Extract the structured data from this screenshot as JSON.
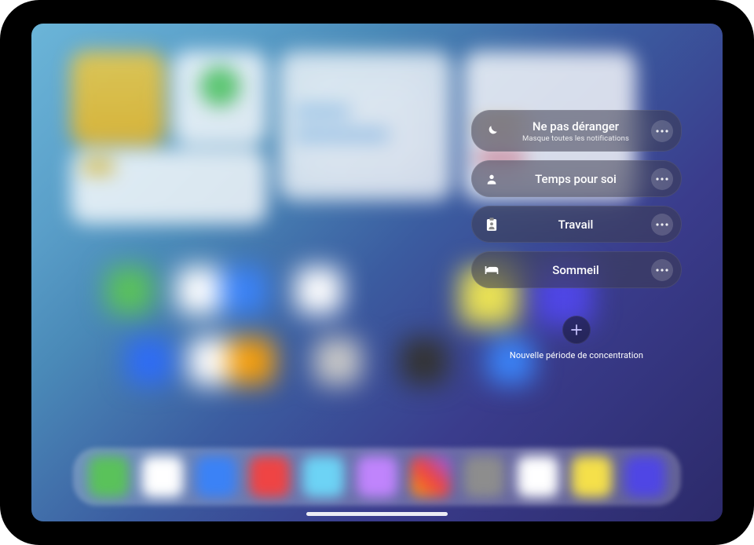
{
  "focus_menu": {
    "options": [
      {
        "id": "dnd",
        "title": "Ne pas déranger",
        "subtitle": "Masque toutes les notifications",
        "icon": "moon-icon"
      },
      {
        "id": "personal",
        "title": "Temps pour soi",
        "subtitle": "",
        "icon": "person-icon"
      },
      {
        "id": "work",
        "title": "Travail",
        "subtitle": "",
        "icon": "badge-icon"
      },
      {
        "id": "sleep",
        "title": "Sommeil",
        "subtitle": "",
        "icon": "bed-icon"
      }
    ],
    "new_focus": {
      "label": "Nouvelle période de concentration"
    }
  }
}
